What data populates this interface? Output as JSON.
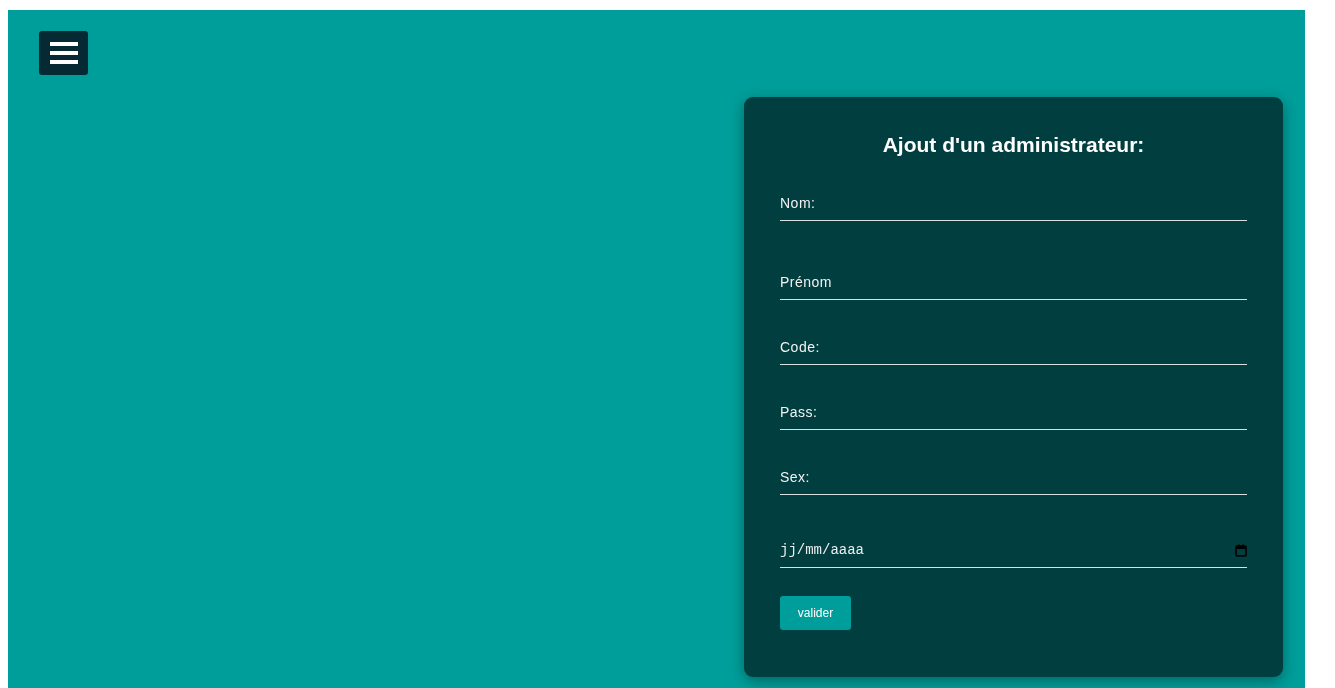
{
  "menu_button": {
    "kind": "hamburger"
  },
  "form": {
    "title": "Ajout d'un administrateur:",
    "fields": [
      {
        "kind": "text",
        "placeholder": "Nom:"
      },
      {
        "kind": "text",
        "placeholder": "Prénom"
      },
      {
        "kind": "text",
        "placeholder": "Code:"
      },
      {
        "kind": "text",
        "placeholder": "Pass:"
      },
      {
        "kind": "text",
        "placeholder": "Sex:"
      },
      {
        "kind": "date",
        "placeholder": "jj/mm/aaaa"
      }
    ],
    "submit": "valider"
  }
}
